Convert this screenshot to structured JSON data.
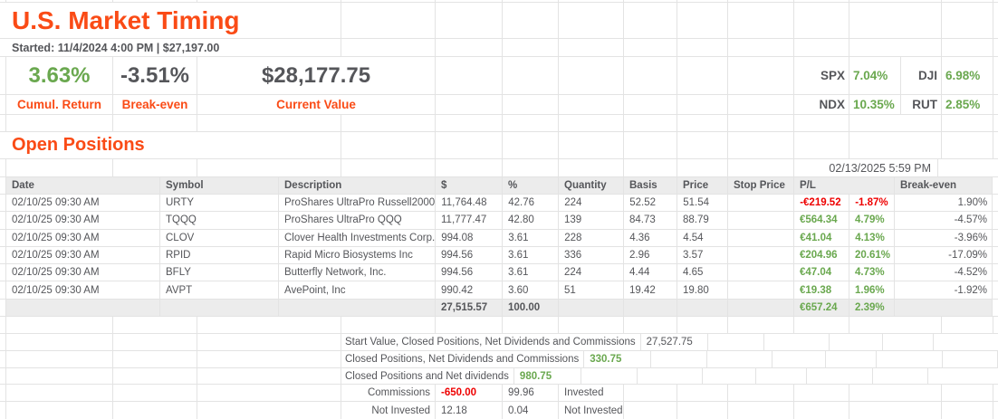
{
  "colors": {
    "accent_orange": "#fa4b16",
    "positive_green": "#6aa84f",
    "negative_red": "#ee0000",
    "text_gray": "#55565a"
  },
  "header": {
    "title": "U.S. Market Timing",
    "subtitle": "Started: 11/4/2024 4:00 PM | $27,197.00"
  },
  "stats": {
    "cumul_return": {
      "value": "3.63%",
      "label": "Cumul. Return"
    },
    "break_even": {
      "value": "-3.51%",
      "label": "Break-even"
    },
    "current_value": {
      "value": "$28,177.75",
      "label": "Current Value"
    }
  },
  "indices": [
    {
      "label": "SPX",
      "value": "7.04%"
    },
    {
      "label": "DJI",
      "value": "6.98%"
    },
    {
      "label": "NDX",
      "value": "10.35%"
    },
    {
      "label": "RUT",
      "value": "2.85%"
    }
  ],
  "positions": {
    "section_title": "Open Positions",
    "as_of": "02/13/2025 5:59 PM",
    "headers": {
      "date": "Date",
      "symbol": "Symbol",
      "description": "Description",
      "dollar": "$",
      "pct": "%",
      "quantity": "Quantity",
      "basis": "Basis",
      "price": "Price",
      "stop_price": "Stop Price",
      "pl": "P/L",
      "break_even": "Break-even"
    },
    "rows": [
      {
        "date": "02/10/25 09:30 AM",
        "symbol": "URTY",
        "description": "ProShares UltraPro Russell2000",
        "dollar": "11,764.48",
        "pct": "42.76",
        "quantity": "224",
        "basis": "52.52",
        "price": "51.54",
        "stop_price": "",
        "pl": "-€219.52",
        "pl_pct": "-1.87%",
        "break_even": "1.90%"
      },
      {
        "date": "02/10/25 09:30 AM",
        "symbol": "TQQQ",
        "description": "ProShares UltraPro QQQ",
        "dollar": "11,777.47",
        "pct": "42.80",
        "quantity": "139",
        "basis": "84.73",
        "price": "88.79",
        "stop_price": "",
        "pl": "€564.34",
        "pl_pct": "4.79%",
        "break_even": "-4.57%"
      },
      {
        "date": "02/10/25 09:30 AM",
        "symbol": "CLOV",
        "description": "Clover Health Investments Corp.",
        "dollar": "994.08",
        "pct": "3.61",
        "quantity": "228",
        "basis": "4.36",
        "price": "4.54",
        "stop_price": "",
        "pl": "€41.04",
        "pl_pct": "4.13%",
        "break_even": "-3.96%"
      },
      {
        "date": "02/10/25 09:30 AM",
        "symbol": "RPID",
        "description": "Rapid Micro Biosystems Inc",
        "dollar": "994.56",
        "pct": "3.61",
        "quantity": "336",
        "basis": "2.96",
        "price": "3.57",
        "stop_price": "",
        "pl": "€204.96",
        "pl_pct": "20.61%",
        "break_even": "-17.09%"
      },
      {
        "date": "02/10/25 09:30 AM",
        "symbol": "BFLY",
        "description": "Butterfly Network, Inc.",
        "dollar": "994.56",
        "pct": "3.61",
        "quantity": "224",
        "basis": "4.44",
        "price": "4.65",
        "stop_price": "",
        "pl": "€47.04",
        "pl_pct": "4.73%",
        "break_even": "-4.52%"
      },
      {
        "date": "02/10/25 09:30 AM",
        "symbol": "AVPT",
        "description": "AvePoint, Inc",
        "dollar": "990.42",
        "pct": "3.60",
        "quantity": "51",
        "basis": "19.42",
        "price": "19.80",
        "stop_price": "",
        "pl": "€19.38",
        "pl_pct": "1.96%",
        "break_even": "-1.92%"
      }
    ],
    "totals": {
      "dollar": "27,515.57",
      "pct": "100.00",
      "pl": "€657.24",
      "pl_pct": "2.39%"
    }
  },
  "summary": {
    "rows": [
      {
        "label": "Start Value, Closed Positions, Net Dividends and Commissions",
        "value": "27,527.75",
        "value2": "",
        "value3": ""
      },
      {
        "label": "Closed Positions, Net Dividends and Commissions",
        "value": "330.75",
        "value2": "",
        "value3": ""
      },
      {
        "label": "Closed Positions and Net dividends",
        "value": "980.75",
        "value2": "",
        "value3": ""
      },
      {
        "label": "Commissions",
        "value": "-650.00",
        "value2": "99.96",
        "value3": "Invested"
      },
      {
        "label": "Not Invested",
        "value": "12.18",
        "value2": "0.04",
        "value3": "Not Invested"
      }
    ]
  }
}
